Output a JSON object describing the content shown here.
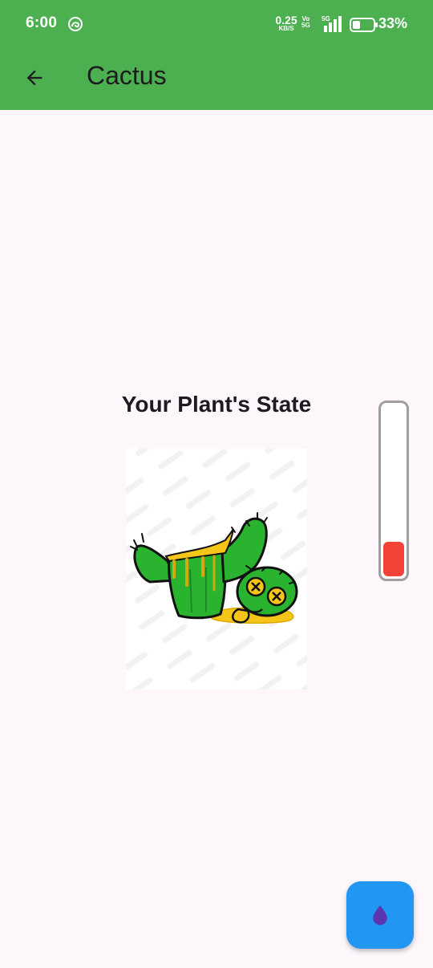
{
  "status_bar": {
    "time": "6:00",
    "speed_value": "0.25",
    "speed_unit": "KB/S",
    "volte_top": "Vo",
    "volte_bottom": "5G",
    "network_label": "5G",
    "battery_percent": "33%"
  },
  "app_bar": {
    "title": "Cactus",
    "back_icon": "arrow-left-icon",
    "color": "#4caf50"
  },
  "main": {
    "state_heading": "Your Plant's State",
    "plant_image_icon": "dead-cactus-illustration",
    "water_level_fraction": 0.2,
    "water_level_color": "#f44336"
  },
  "fab": {
    "icon": "water-drop-icon",
    "color": "#2196f3"
  }
}
